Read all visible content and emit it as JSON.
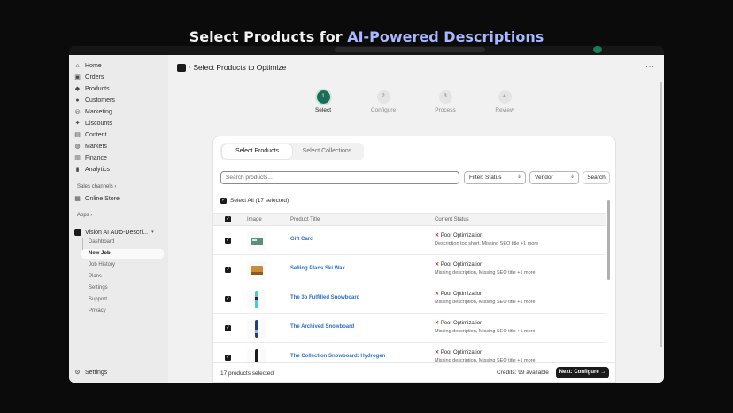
{
  "headline": {
    "prefix": "Select Products for ",
    "accent": "AI-Powered Descriptions"
  },
  "sidebar": {
    "items": [
      {
        "label": "Home",
        "icon": "⌂"
      },
      {
        "label": "Orders",
        "icon": "▣"
      },
      {
        "label": "Products",
        "icon": "◆"
      },
      {
        "label": "Customers",
        "icon": "●"
      },
      {
        "label": "Marketing",
        "icon": "◎"
      },
      {
        "label": "Discounts",
        "icon": "✦"
      },
      {
        "label": "Content",
        "icon": "▤"
      },
      {
        "label": "Markets",
        "icon": "◍"
      },
      {
        "label": "Finance",
        "icon": "▥"
      },
      {
        "label": "Analytics",
        "icon": "▮"
      }
    ],
    "sales_channels_label": "Sales channels ›",
    "online_store": "Online Store",
    "apps_label": "Apps ›",
    "app_name": "Vision AI Auto-Descri...",
    "app_chevron": "▾",
    "app_sub_items": [
      "Dashboard",
      "New Job",
      "Job History",
      "Plans",
      "Settings",
      "Support",
      "Privacy"
    ],
    "settings": "Settings"
  },
  "header": {
    "chevron": "›",
    "title": "Select Products to Optimize",
    "menu": "···"
  },
  "stepper": [
    {
      "num": "1",
      "label": "Select"
    },
    {
      "num": "2",
      "label": "Configure"
    },
    {
      "num": "3",
      "label": "Process"
    },
    {
      "num": "4",
      "label": "Review"
    }
  ],
  "tabs": [
    "Select Products",
    "Select Collections"
  ],
  "search": {
    "placeholder": "Search products..."
  },
  "filters": {
    "status": "Filter: Status",
    "vendor": "Vendor",
    "arrow": "⇕",
    "search_button": "Search"
  },
  "select_all": "Select All (17 selected)",
  "table": {
    "headers": [
      "Image",
      "Product Title",
      "Current Status"
    ],
    "rows": [
      {
        "title": "Gift Card",
        "status": "Poor Optimization",
        "detail": "Description too short, Missing SEO title +1 more"
      },
      {
        "title": "Selling Plans Ski Wax",
        "status": "Poor Optimization",
        "detail": "Missing description, Missing SEO title +1 more"
      },
      {
        "title": "The 3p Fulfilled Snowboard",
        "status": "Poor Optimization",
        "detail": "Missing description, Missing SEO title +1 more"
      },
      {
        "title": "The Archived Snowboard",
        "status": "Poor Optimization",
        "detail": "Missing description, Missing SEO title +1 more"
      },
      {
        "title": "The Collection Snowboard: Hydrogen",
        "status": "Poor Optimization",
        "detail": "Missing description, Missing SEO title +1 more"
      }
    ]
  },
  "footer": {
    "count": "17 products selected",
    "credits": "Credits: 99 available",
    "next": "Next: Configure →"
  },
  "colors": {
    "accent_green": "#1b6e55",
    "link_blue": "#2c6ecb",
    "error_red": "#d72c0d"
  }
}
